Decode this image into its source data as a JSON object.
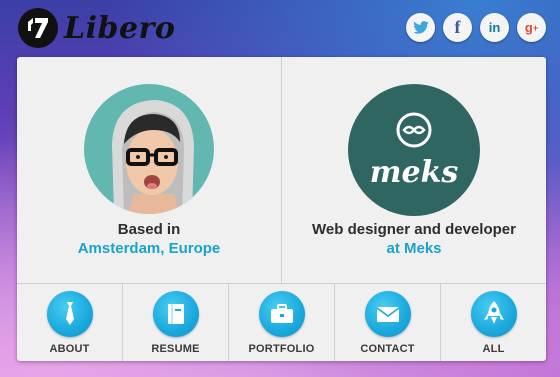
{
  "brand": {
    "name": "Libero"
  },
  "social": [
    {
      "icon": "twitter-icon",
      "glyph": "🐦",
      "color": "#3aa7df"
    },
    {
      "icon": "facebook-icon",
      "glyph": "f",
      "color": "#3b5998"
    },
    {
      "icon": "linkedin-icon",
      "glyph": "in",
      "color": "#0e76a8"
    },
    {
      "icon": "google-plus-icon",
      "glyph": "g+",
      "color": "#dd4b39"
    }
  ],
  "cards": {
    "left": {
      "line1": "Based in",
      "line2": "Amsterdam, Europe"
    },
    "right": {
      "logo_text": "meks",
      "line1": "Web designer and developer",
      "line2": "at Meks"
    }
  },
  "nav": [
    {
      "label": "ABOUT",
      "icon": "tie-icon"
    },
    {
      "label": "RESUME",
      "icon": "book-icon"
    },
    {
      "label": "PORTFOLIO",
      "icon": "briefcase-icon"
    },
    {
      "label": "CONTACT",
      "icon": "envelope-icon"
    },
    {
      "label": "ALL",
      "icon": "rocket-icon"
    }
  ],
  "colors": {
    "accent": "#1aa3c9",
    "text": "#2e2e2e",
    "panel": "#f0f0f0",
    "meks_green": "#2f6662",
    "avatar_bg": "#62b8b1"
  }
}
